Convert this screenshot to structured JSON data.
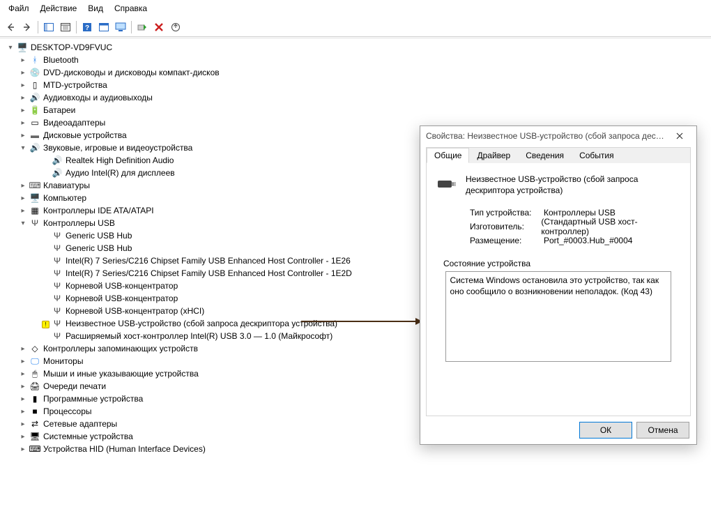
{
  "menu": {
    "file": "Файл",
    "action": "Действие",
    "view": "Вид",
    "help": "Справка"
  },
  "toolbar_icons": {
    "back": "←",
    "forward": "→",
    "separator": "|",
    "props": "▤",
    "list": "≣",
    "help": "?",
    "window": "▭",
    "scan": "🖵",
    "refresh": "⟳",
    "delete": "✕",
    "update": "⭳"
  },
  "tree": {
    "root": "DESKTOP-VD9FVUC",
    "nodes": {
      "bluetooth": "Bluetooth",
      "dvd": "DVD-дисководы и дисководы компакт-дисков",
      "mtd": "MTD-устройства",
      "audio_io": "Аудиовходы и аудиовыходы",
      "batteries": "Батареи",
      "video": "Видеоадаптеры",
      "disks": "Дисковые устройства",
      "sound": "Звуковые, игровые и видеоустройства",
      "sound_children": {
        "realtek": "Realtek High Definition Audio",
        "intel_display": "Аудио Intel(R) для дисплеев"
      },
      "keyboards": "Клавиатуры",
      "computer": "Компьютер",
      "ide": "Контроллеры IDE ATA/ATAPI",
      "usb": "Контроллеры USB",
      "usb_children": {
        "hub1": "Generic USB Hub",
        "hub2": "Generic USB Hub",
        "intel1": "Intel(R) 7 Series/C216 Chipset Family USB Enhanced Host Controller - 1E26",
        "intel2": "Intel(R) 7 Series/C216 Chipset Family USB Enhanced Host Controller - 1E2D",
        "root1": "Корневой USB-концентратор",
        "root2": "Корневой USB-концентратор",
        "root3": "Корневой USB-концентратор (xHCI)",
        "unknown": "Неизвестное USB-устройство (сбой запроса дескриптора устройства)",
        "xhc": "Расширяемый хост-контроллер Intel(R) USB 3.0 — 1.0 (Майкрософт)"
      },
      "storage_ctrl": "Контроллеры запоминающих устройств",
      "monitors": "Мониторы",
      "mice": "Мыши и иные указывающие устройства",
      "printqueue": "Очереди печати",
      "software": "Программные устройства",
      "cpu": "Процессоры",
      "network": "Сетевые адаптеры",
      "system": "Системные устройства",
      "hid": "Устройства HID (Human Interface Devices)"
    }
  },
  "dialog": {
    "title": "Свойства: Неизвестное USB-устройство (сбой запроса дескрип...",
    "tabs": {
      "general": "Общие",
      "driver": "Драйвер",
      "info": "Сведения",
      "events": "События"
    },
    "device_title": "Неизвестное USB-устройство (сбой запроса дескриптора устройства)",
    "info_labels": {
      "type": "Тип устройства:",
      "manufacturer": "Изготовитель:",
      "location": "Размещение:"
    },
    "info_values": {
      "type": "Контроллеры USB",
      "manufacturer": "(Стандартный USB хост-контроллер)",
      "location": "Port_#0003.Hub_#0004"
    },
    "status_label": "Состояние устройства",
    "status_text": "Система Windows остановила это устройство, так как оно сообщило о возникновении неполадок. (Код 43)",
    "buttons": {
      "ok": "ОК",
      "cancel": "Отмена"
    }
  }
}
